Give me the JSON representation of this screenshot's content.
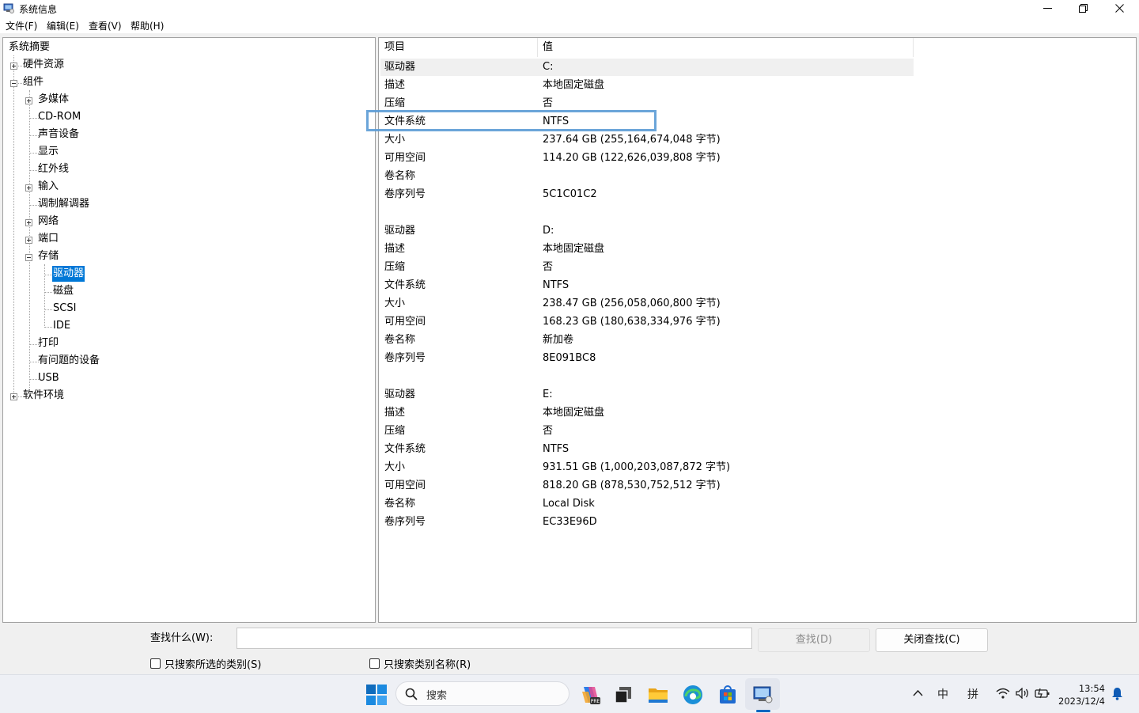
{
  "window": {
    "title": "系统信息",
    "controls": {
      "minimize": "minimize-icon",
      "maximize": "restore-icon",
      "close": "close-icon"
    }
  },
  "menu": [
    "文件(F)",
    "编辑(E)",
    "查看(V)",
    "帮助(H)"
  ],
  "tree": {
    "root": "系统摘要",
    "hardware": "硬件资源",
    "components": "组件",
    "multimedia": "多媒体",
    "cdrom": "CD-ROM",
    "sound": "声音设备",
    "display": "显示",
    "infrared": "红外线",
    "input": "输入",
    "modem": "调制解调器",
    "network": "网络",
    "ports": "端口",
    "storage": "存储",
    "drives": "驱动器",
    "disks": "磁盘",
    "scsi": "SCSI",
    "ide": "IDE",
    "print": "打印",
    "problem_devices": "有问题的设备",
    "usb": "USB",
    "software": "软件环境"
  },
  "detail": {
    "headers": {
      "item": "项目",
      "value": "值"
    },
    "drives": [
      {
        "rows": [
          [
            "驱动器",
            "C:"
          ],
          [
            "描述",
            "本地固定磁盘"
          ],
          [
            "压缩",
            "否"
          ],
          [
            "文件系统",
            "NTFS"
          ],
          [
            "大小",
            "237.64 GB (255,164,674,048 字节)"
          ],
          [
            "可用空间",
            "114.20 GB (122,626,039,808 字节)"
          ],
          [
            "卷名称",
            ""
          ],
          [
            "卷序列号",
            "5C1C01C2"
          ]
        ]
      },
      {
        "rows": [
          [
            "驱动器",
            "D:"
          ],
          [
            "描述",
            "本地固定磁盘"
          ],
          [
            "压缩",
            "否"
          ],
          [
            "文件系统",
            "NTFS"
          ],
          [
            "大小",
            "238.47 GB (256,058,060,800 字节)"
          ],
          [
            "可用空间",
            "168.23 GB (180,638,334,976 字节)"
          ],
          [
            "卷名称",
            "新加卷"
          ],
          [
            "卷序列号",
            "8E091BC8"
          ]
        ]
      },
      {
        "rows": [
          [
            "驱动器",
            "E:"
          ],
          [
            "描述",
            "本地固定磁盘"
          ],
          [
            "压缩",
            "否"
          ],
          [
            "文件系统",
            "NTFS"
          ],
          [
            "大小",
            "931.51 GB (1,000,203,087,872 字节)"
          ],
          [
            "可用空间",
            "818.20 GB (878,530,752,512 字节)"
          ],
          [
            "卷名称",
            "Local Disk"
          ],
          [
            "卷序列号",
            "EC33E96D"
          ]
        ]
      }
    ]
  },
  "search": {
    "label": "查找什么(W):",
    "value": "",
    "find_button": "查找(D)",
    "close_button": "关闭查找(C)",
    "checkbox_selected_category": "只搜索所选的类别(S)",
    "checkbox_category_names": "只搜索类别名称(R)"
  },
  "taskbar": {
    "search_placeholder": "搜索",
    "apps": [
      "start-icon",
      "copilot-icon",
      "task-view-icon",
      "file-explorer-icon",
      "edge-icon",
      "store-icon",
      "system-info-icon"
    ],
    "tray": {
      "ime_lang": "中",
      "ime_mode": "拼",
      "time": "13:54",
      "date": "2023/12/4"
    }
  },
  "colors": {
    "selection": "#0078d7",
    "focus_box": "#5b9bd5",
    "taskbar_accent": "#0067c0"
  }
}
